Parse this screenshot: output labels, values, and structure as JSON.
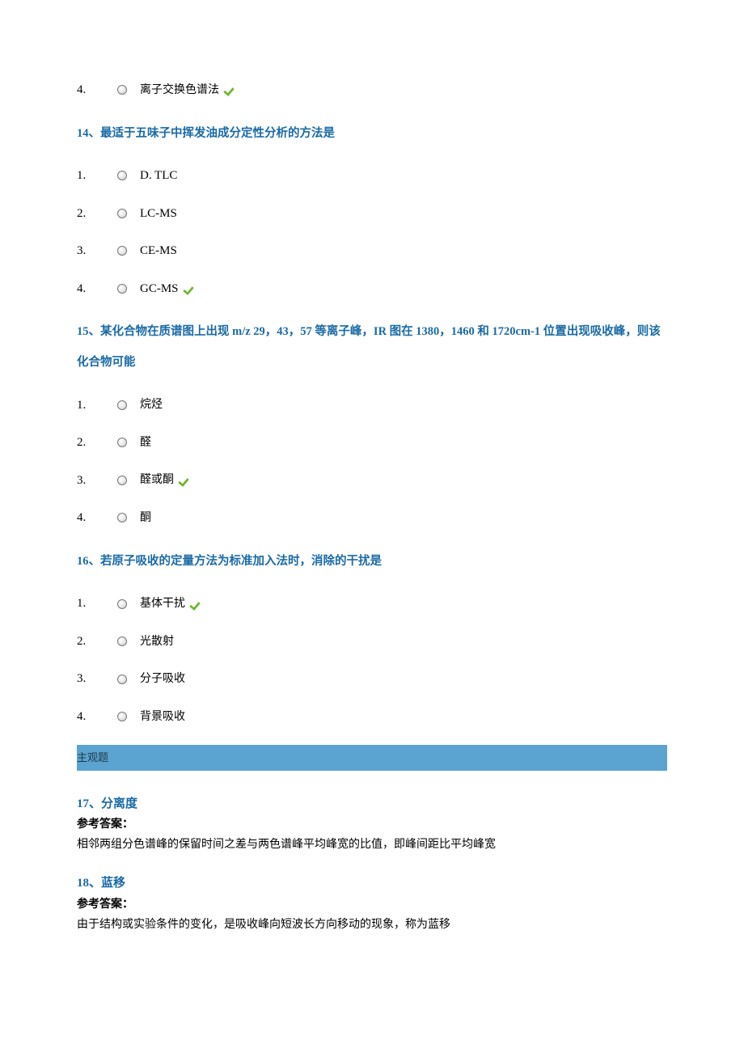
{
  "orphan_option": {
    "num": "4.",
    "text": "离子交换色谱法",
    "correct": true
  },
  "q14": {
    "title": "14、最适于五味子中挥发油成分定性分析的方法是",
    "options": [
      {
        "num": "1.",
        "text": "D. TLC",
        "correct": false,
        "latin": true
      },
      {
        "num": "2.",
        "text": "LC-MS",
        "correct": false,
        "latin": true
      },
      {
        "num": "3.",
        "text": "CE-MS",
        "correct": false,
        "latin": true
      },
      {
        "num": "4.",
        "text": "GC-MS",
        "correct": true,
        "latin": true
      }
    ]
  },
  "q15": {
    "title_pre": "15、某化合物在质谱图上出现 ",
    "title_mid": "m/z 29，43，57 ",
    "title_mid2": "等离子峰，",
    "title_ir": "IR ",
    "title_mid3": "图在 ",
    "title_nums": "1380，1460 ",
    "title_and": "和 ",
    "title_cm": "1720cm-1 ",
    "title_end": "位置出现吸收峰，则该化合物可能",
    "options": [
      {
        "num": "1.",
        "text": "烷烃",
        "correct": false
      },
      {
        "num": "2.",
        "text": "醛",
        "correct": false
      },
      {
        "num": "3.",
        "text": "醛或酮",
        "correct": true
      },
      {
        "num": "4.",
        "text": "酮",
        "correct": false
      }
    ]
  },
  "q16": {
    "title": "16、若原子吸收的定量方法为标准加入法时，消除的干扰是",
    "options": [
      {
        "num": "1.",
        "text": "基体干扰",
        "correct": true
      },
      {
        "num": "2.",
        "text": "光散射",
        "correct": false
      },
      {
        "num": "3.",
        "text": "分子吸收",
        "correct": false
      },
      {
        "num": "4.",
        "text": "背景吸收",
        "correct": false
      }
    ]
  },
  "section_label": "主观题",
  "q17": {
    "title": "17、分离度",
    "answer_label": "参考答案：",
    "answer": "相邻两组分色谱峰的保留时间之差与两色谱峰平均峰宽的比值，即峰间距比平均峰宽"
  },
  "q18": {
    "title": "18、蓝移",
    "answer_label": "参考答案：",
    "answer": "由于结构或实验条件的变化，是吸收峰向短波长方向移动的现象，称为蓝移"
  }
}
